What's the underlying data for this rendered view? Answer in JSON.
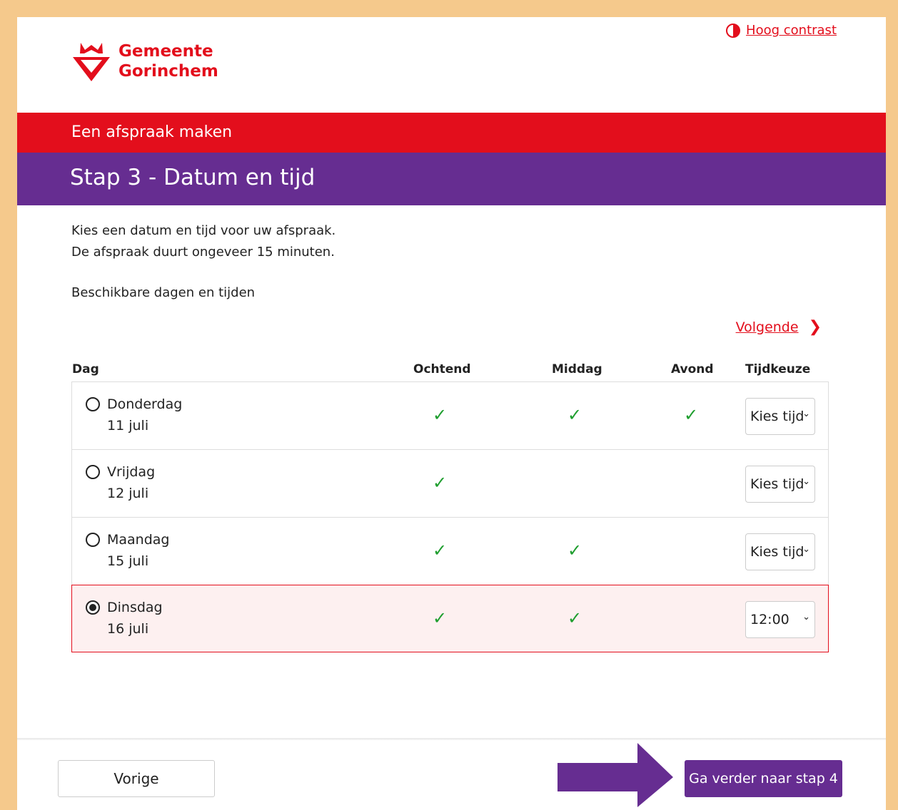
{
  "header": {
    "logo_line1": "Gemeente",
    "logo_line2": "Gorinchem",
    "contrast_label": "Hoog contrast"
  },
  "banner": {
    "title": "Een afspraak maken"
  },
  "step": {
    "title": "Stap 3 - Datum en tijd"
  },
  "intro": {
    "line1": "Kies een datum en tijd voor uw afspraak.",
    "line2": "De afspraak duurt ongeveer 15 minuten."
  },
  "available_label": "Beschikbare dagen en tijden",
  "next_link": "Volgende",
  "table": {
    "headers": {
      "day": "Dag",
      "morning": "Ochtend",
      "afternoon": "Middag",
      "evening": "Avond",
      "time": "Tijdkeuze"
    },
    "rows": [
      {
        "day": "Donderdag",
        "date": "11 juli",
        "morning": true,
        "afternoon": true,
        "evening": true,
        "time": "Kies tijd",
        "selected": false
      },
      {
        "day": "Vrijdag",
        "date": "12 juli",
        "morning": true,
        "afternoon": false,
        "evening": false,
        "time": "Kies tijd",
        "selected": false
      },
      {
        "day": "Maandag",
        "date": "15 juli",
        "morning": true,
        "afternoon": true,
        "evening": false,
        "time": "Kies tijd",
        "selected": false
      },
      {
        "day": "Dinsdag",
        "date": "16 juli",
        "morning": true,
        "afternoon": true,
        "evening": false,
        "time": "12:00",
        "selected": true
      }
    ]
  },
  "footer": {
    "prev_label": "Vorige",
    "next_label": "Ga verder naar stap 4"
  },
  "icons": {
    "contrast": "contrast-icon",
    "chevron": "chevron-right-icon",
    "check": "check-icon",
    "caret": "chevron-down-icon",
    "arrow": "arrow-right-icon"
  },
  "colors": {
    "brand_red": "#e30e1c",
    "brand_purple": "#662d91",
    "check_green": "#1e9e2e",
    "selected_row_bg": "#fdf0f0",
    "page_border": "#f5c98c"
  }
}
